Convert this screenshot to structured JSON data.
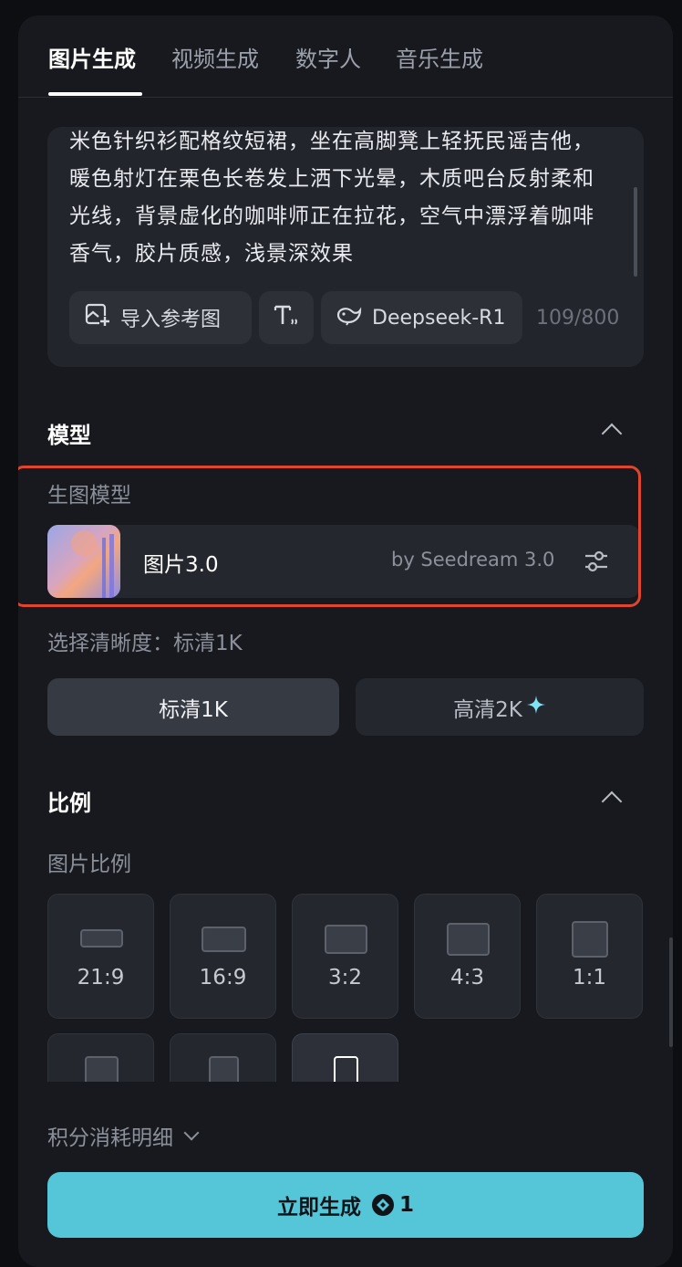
{
  "tabs": [
    {
      "label": "图片生成",
      "active": true
    },
    {
      "label": "视频生成",
      "active": false
    },
    {
      "label": "数字人",
      "active": false
    },
    {
      "label": "音乐生成",
      "active": false
    }
  ],
  "prompt": {
    "text": "米色针织衫配格纹短裙，坐在高脚凳上轻抚民谣吉他，暖色射灯在栗色长卷发上洒下光晕，木质吧台反射柔和光线，背景虚化的咖啡师正在拉花，空气中漂浮着咖啡香气，胶片质感，浅景深效果",
    "import_ref_label": "导入参考图",
    "text_tool_icon": "text-format-icon",
    "model_label": "Deepseek-R1",
    "char_count": "109/800"
  },
  "model_section": {
    "title": "模型",
    "sub_label": "生图模型",
    "model_name": "图片3.0",
    "model_by": "by Seedream 3.0",
    "resolution_label": "选择清晰度：标清1K",
    "resolutions": [
      {
        "label": "标清1K",
        "selected": true
      },
      {
        "label": "高清2K",
        "selected": false
      }
    ]
  },
  "ratio_section": {
    "title": "比例",
    "sub_label": "图片比例",
    "ratios": [
      {
        "label": "21:9"
      },
      {
        "label": "16:9"
      },
      {
        "label": "3:2"
      },
      {
        "label": "4:3"
      },
      {
        "label": "1:1"
      },
      {
        "label": ""
      },
      {
        "label": ""
      },
      {
        "label": ""
      }
    ]
  },
  "points_label": "积分消耗明细",
  "generate": {
    "label": "立即生成",
    "cost": "1"
  },
  "colors": {
    "accent": "#55c5d8",
    "highlight": "#e0452e",
    "panel": "#17191e"
  }
}
